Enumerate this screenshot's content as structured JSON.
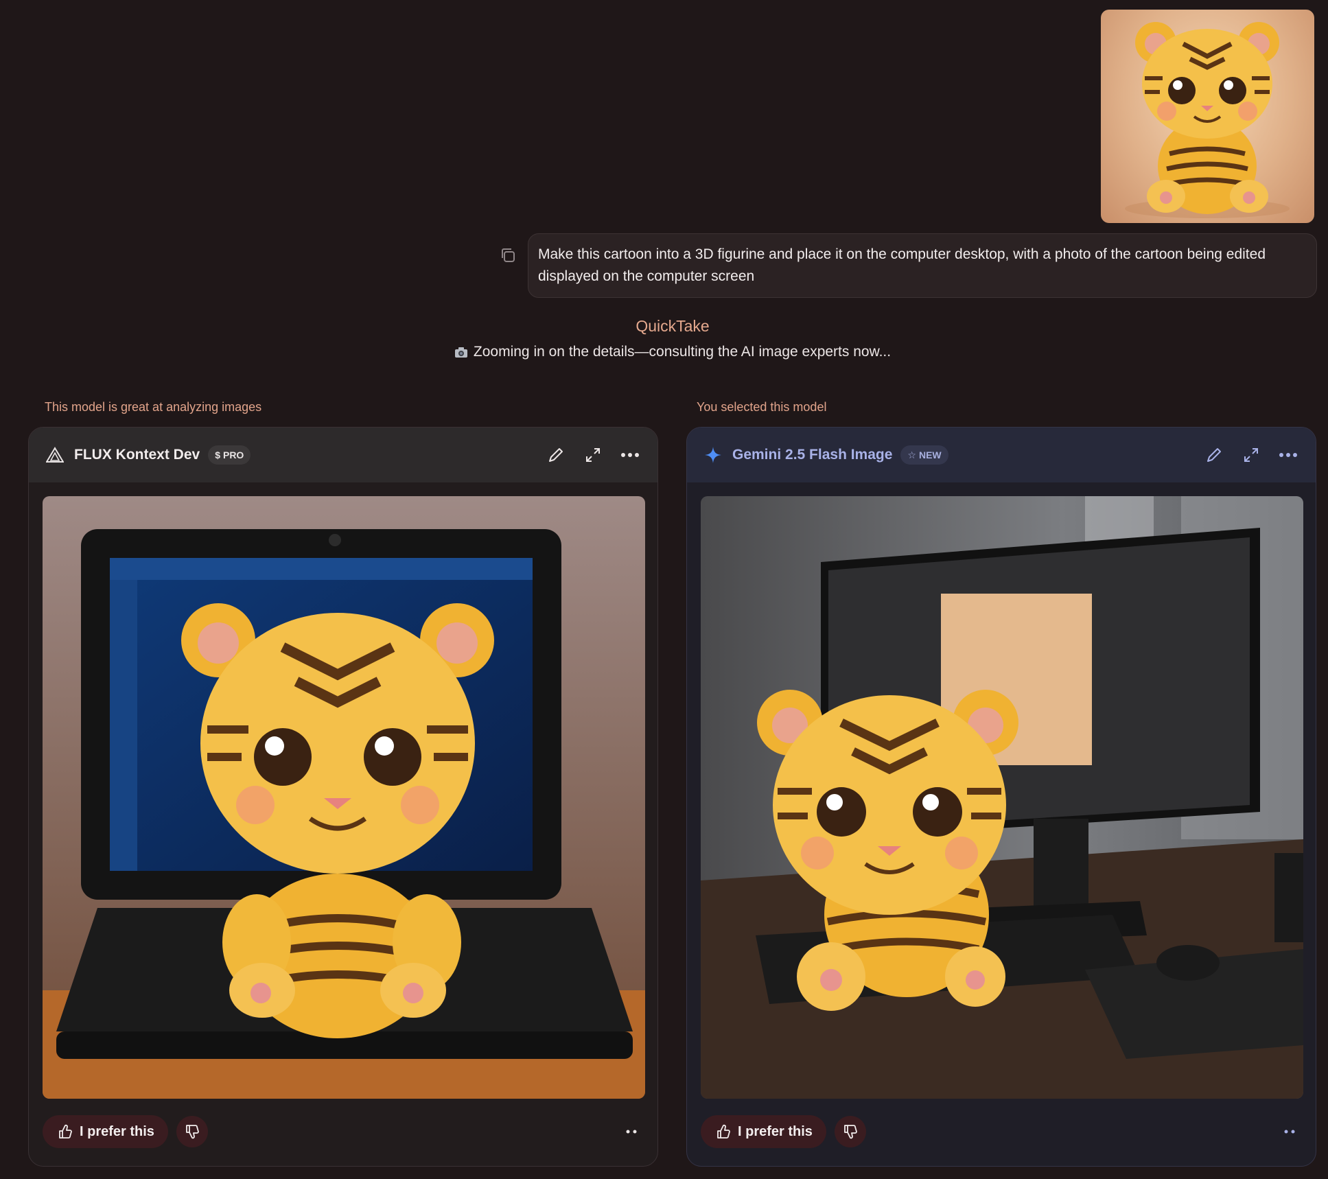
{
  "user_message": {
    "text": "Make this cartoon into a 3D figurine and place it on the computer desktop, with a photo of the cartoon being edited displayed on the computer screen",
    "attachment_icon": "tiger-cub-cartoon-image",
    "copy_icon": "copy-icon"
  },
  "quicktake": {
    "title": "QuickTake",
    "status": "Zooming in on the details—consulting the AI image experts now..."
  },
  "models": [
    {
      "caption": "This model is great at analyzing images",
      "name": "FLUX Kontext Dev",
      "badge_symbol": "$",
      "badge": "PRO",
      "icon": "flux-triangle-icon",
      "prefer_label": "I prefer this",
      "result_scene": "figurine-on-laptop"
    },
    {
      "caption": "You selected this model",
      "name": "Gemini 2.5 Flash Image",
      "badge_symbol": "☆",
      "badge": "NEW",
      "icon": "gemini-sparkle-icon",
      "prefer_label": "I prefer this",
      "result_scene": "figurine-on-desk-with-monitor"
    }
  ],
  "colors": {
    "background": "#1f1718",
    "accent": "#e5a98e",
    "gemini_accent": "#a9b2e8",
    "prefer_button": "#3a1c20"
  }
}
